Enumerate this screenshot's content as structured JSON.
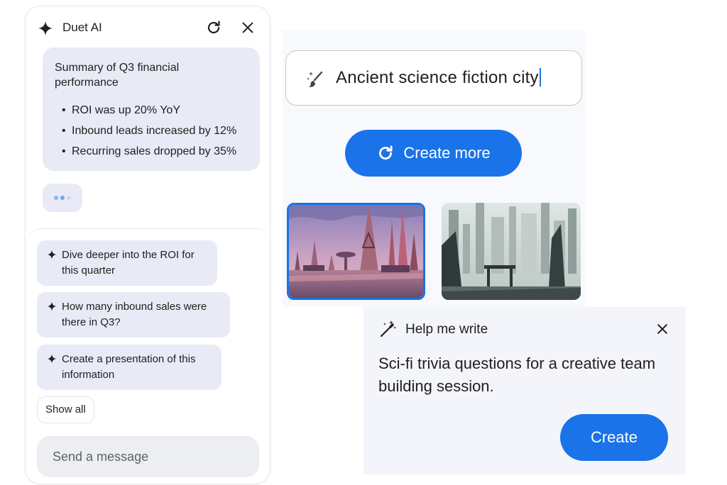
{
  "duet": {
    "title": "Duet AI",
    "summary_title": "Summary of Q3 financial performance",
    "bullets": [
      "ROI was up 20% YoY",
      "Inbound leads increased by 12%",
      "Recurring sales dropped by 35%"
    ],
    "suggestions": [
      "Dive deeper into the ROI for this quarter",
      "How many inbound sales were there in Q3?",
      "Create a presentation of this information"
    ],
    "show_all": "Show all",
    "message_placeholder": "Send a message"
  },
  "image_gen": {
    "prompt_value": "Ancient science fiction city",
    "create_more_label": "Create more"
  },
  "help_write": {
    "title": "Help me write",
    "body": "Sci-fi trivia questions for a creative team building session.",
    "create_label": "Create"
  },
  "colors": {
    "accent": "#1a73e8",
    "chip_bg": "#e8ebf5"
  },
  "icons": [
    "sparkle-icon",
    "refresh-icon",
    "close-icon",
    "magic-brush-icon",
    "magic-wand-icon"
  ]
}
